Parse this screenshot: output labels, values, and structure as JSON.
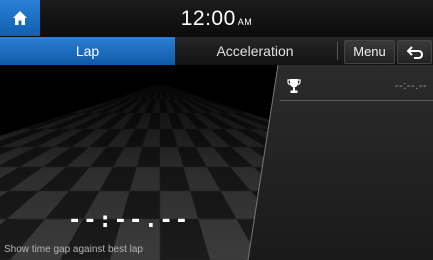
{
  "status_bar": {
    "time": "12:00",
    "ampm": "AM",
    "home_icon": "home-icon"
  },
  "tabs": {
    "lap_label": "Lap",
    "acceleration_label": "Acceleration",
    "menu_label": "Menu",
    "back_icon": "back-arrow-icon"
  },
  "main": {
    "lap_time": "--:--.--",
    "best_lap_icon": "trophy-icon",
    "best_lap_time": "--:--.--",
    "hint": "Show time gap against best lap"
  },
  "colors": {
    "accent": "#1f6fc2",
    "background": "#000000"
  }
}
